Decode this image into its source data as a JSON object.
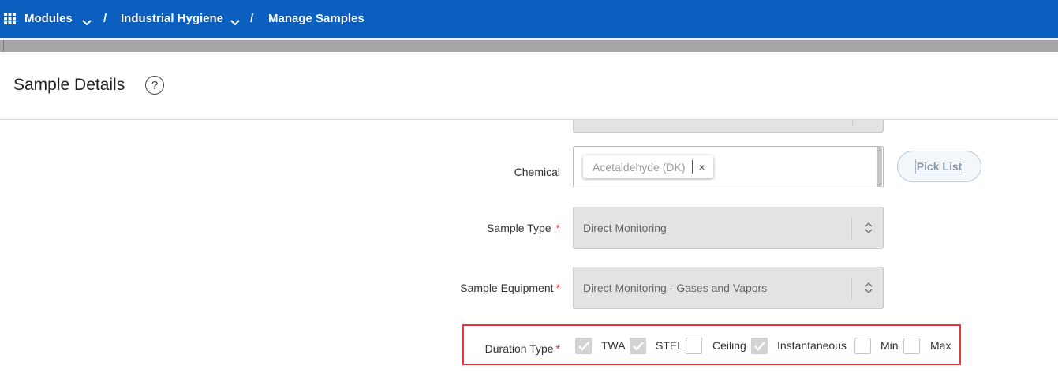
{
  "breadcrumb": {
    "modules": "Modules",
    "separator": "/",
    "module": "Industrial Hygiene",
    "page": "Manage Samples"
  },
  "header": {
    "title": "Sample Details",
    "help": "?"
  },
  "form": {
    "chemical": {
      "label": "Chemical",
      "chip": "Acetaldehyde (DK)",
      "chip_remove": "×",
      "picklist": "Pick List"
    },
    "sample_type": {
      "label": "Sample Type",
      "required": "*",
      "value": "Direct Monitoring"
    },
    "sample_equipment": {
      "label": "Sample Equipment",
      "required": "*",
      "value": "Direct Monitoring - Gases and Vapors"
    },
    "duration_type": {
      "label": "Duration Type",
      "required": "*",
      "options": [
        {
          "label": "TWA",
          "checked": true
        },
        {
          "label": "STEL",
          "checked": true
        },
        {
          "label": "Ceiling",
          "checked": false
        },
        {
          "label": "Instantaneous",
          "checked": true
        },
        {
          "label": "Min",
          "checked": false
        },
        {
          "label": "Max",
          "checked": false
        }
      ]
    }
  },
  "colors": {
    "topbar": "#0b5fbf",
    "required": "#d9342b",
    "highlight_border": "#e0393f",
    "disabled_field": "#e3e3e3"
  },
  "icons": {
    "apps": "grid-icon",
    "dropdown": "chevron-down-icon",
    "help": "help-circle-icon",
    "select": "updown-arrows-icon",
    "remove": "close-icon",
    "check": "check-icon"
  }
}
